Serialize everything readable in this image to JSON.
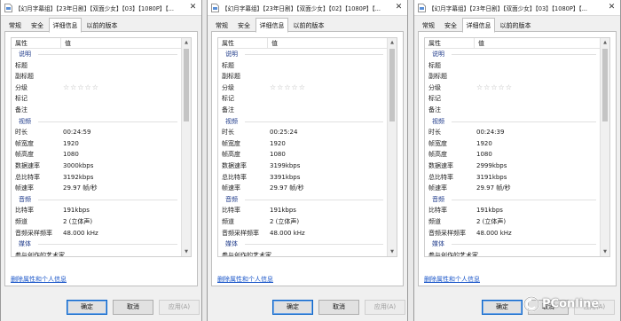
{
  "windows": [
    {
      "title": "【幻月字幕组】【23年日剧】【双面少女】【03】【1080P】【...",
      "close": "✕",
      "tabs": [
        "常规",
        "安全",
        "详细信息",
        "以前的版本"
      ],
      "active_tab": 2,
      "columns": {
        "name": "属性",
        "value": "值"
      },
      "rows": [
        {
          "type": "section",
          "k": "说明"
        },
        {
          "k": "标题",
          "v": ""
        },
        {
          "k": "副标题",
          "v": ""
        },
        {
          "k": "分级",
          "v": "☆☆☆☆☆",
          "stars": true
        },
        {
          "k": "标记",
          "v": ""
        },
        {
          "k": "备注",
          "v": ""
        },
        {
          "type": "section",
          "k": "视频"
        },
        {
          "k": "时长",
          "v": "00:24:59"
        },
        {
          "k": "帧宽度",
          "v": "1920"
        },
        {
          "k": "帧高度",
          "v": "1080"
        },
        {
          "k": "数据速率",
          "v": "3000kbps"
        },
        {
          "k": "总比特率",
          "v": "3192kbps"
        },
        {
          "k": "帧速率",
          "v": "29.97 帧/秒"
        },
        {
          "type": "section",
          "k": "音频"
        },
        {
          "k": "比特率",
          "v": "191kbps"
        },
        {
          "k": "频道",
          "v": "2 (立体声)"
        },
        {
          "k": "音频采样频率",
          "v": "48.000 kHz"
        },
        {
          "type": "section",
          "k": "媒体"
        },
        {
          "k": "参与创作的艺术家",
          "v": ""
        },
        {
          "k": "年",
          "v": ""
        }
      ],
      "link": "删除属性和个人信息",
      "buttons": {
        "ok": "确定",
        "cancel": "取消",
        "apply": "应用(A)"
      }
    },
    {
      "title": "【幻月字幕组】【23年日剧】【双面少女】【02】【1080P】【...",
      "close": "✕",
      "tabs": [
        "常规",
        "安全",
        "详细信息",
        "以前的版本"
      ],
      "active_tab": 2,
      "columns": {
        "name": "属性",
        "value": "值"
      },
      "rows": [
        {
          "type": "section",
          "k": "说明"
        },
        {
          "k": "标题",
          "v": ""
        },
        {
          "k": "副标题",
          "v": ""
        },
        {
          "k": "分级",
          "v": "☆☆☆☆☆",
          "stars": true
        },
        {
          "k": "标记",
          "v": ""
        },
        {
          "k": "备注",
          "v": ""
        },
        {
          "type": "section",
          "k": "视频"
        },
        {
          "k": "时长",
          "v": "00:25:24"
        },
        {
          "k": "帧宽度",
          "v": "1920"
        },
        {
          "k": "帧高度",
          "v": "1080"
        },
        {
          "k": "数据速率",
          "v": "3199kbps"
        },
        {
          "k": "总比特率",
          "v": "3391kbps"
        },
        {
          "k": "帧速率",
          "v": "29.97 帧/秒"
        },
        {
          "type": "section",
          "k": "音频"
        },
        {
          "k": "比特率",
          "v": "191kbps"
        },
        {
          "k": "频道",
          "v": "2 (立体声)"
        },
        {
          "k": "音频采样频率",
          "v": "48.000 kHz"
        },
        {
          "type": "section",
          "k": "媒体"
        },
        {
          "k": "参与创作的艺术家",
          "v": ""
        },
        {
          "k": "年",
          "v": ""
        }
      ],
      "link": "删除属性和个人信息",
      "buttons": {
        "ok": "确定",
        "cancel": "取消",
        "apply": "应用(A)"
      }
    },
    {
      "title": "【幻月字幕组】【23年日剧】【双面少女】【03】【1080P】【...",
      "close": "✕",
      "tabs": [
        "常规",
        "安全",
        "详细信息",
        "以前的版本"
      ],
      "active_tab": 2,
      "columns": {
        "name": "属性",
        "value": "值"
      },
      "rows": [
        {
          "type": "section",
          "k": "说明"
        },
        {
          "k": "标题",
          "v": ""
        },
        {
          "k": "副标题",
          "v": ""
        },
        {
          "k": "分级",
          "v": "☆☆☆☆☆",
          "stars": true
        },
        {
          "k": "标记",
          "v": ""
        },
        {
          "k": "备注",
          "v": ""
        },
        {
          "type": "section",
          "k": "视频"
        },
        {
          "k": "时长",
          "v": "00:24:39"
        },
        {
          "k": "帧宽度",
          "v": "1920"
        },
        {
          "k": "帧高度",
          "v": "1080"
        },
        {
          "k": "数据速率",
          "v": "2999kbps"
        },
        {
          "k": "总比特率",
          "v": "3191kbps"
        },
        {
          "k": "帧速率",
          "v": "29.97 帧/秒"
        },
        {
          "type": "section",
          "k": "音频"
        },
        {
          "k": "比特率",
          "v": "191kbps"
        },
        {
          "k": "频道",
          "v": "2 (立体声)"
        },
        {
          "k": "音频采样频率",
          "v": "48.000 kHz"
        },
        {
          "type": "section",
          "k": "媒体"
        },
        {
          "k": "参与创作的艺术家",
          "v": ""
        },
        {
          "k": "年",
          "v": ""
        }
      ],
      "link": "删除属性和个人信息",
      "buttons": {
        "ok": "确定",
        "cancel": "取消",
        "apply": "应用(A)"
      }
    }
  ],
  "watermark": "PConline",
  "colors": {
    "link": "#1a56c9",
    "section": "#1e3a8a",
    "default_button_border": "#0a64c8",
    "watermark_logo": "#d8262e"
  }
}
